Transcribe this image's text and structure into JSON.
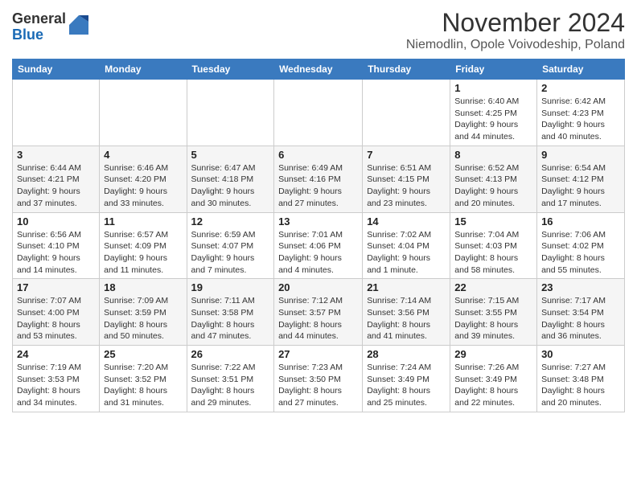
{
  "header": {
    "logo_general": "General",
    "logo_blue": "Blue",
    "month_year": "November 2024",
    "location": "Niemodlin, Opole Voivodeship, Poland"
  },
  "days_of_week": [
    "Sunday",
    "Monday",
    "Tuesday",
    "Wednesday",
    "Thursday",
    "Friday",
    "Saturday"
  ],
  "weeks": [
    [
      {
        "day": "",
        "info": ""
      },
      {
        "day": "",
        "info": ""
      },
      {
        "day": "",
        "info": ""
      },
      {
        "day": "",
        "info": ""
      },
      {
        "day": "",
        "info": ""
      },
      {
        "day": "1",
        "info": "Sunrise: 6:40 AM\nSunset: 4:25 PM\nDaylight: 9 hours\nand 44 minutes."
      },
      {
        "day": "2",
        "info": "Sunrise: 6:42 AM\nSunset: 4:23 PM\nDaylight: 9 hours\nand 40 minutes."
      }
    ],
    [
      {
        "day": "3",
        "info": "Sunrise: 6:44 AM\nSunset: 4:21 PM\nDaylight: 9 hours\nand 37 minutes."
      },
      {
        "day": "4",
        "info": "Sunrise: 6:46 AM\nSunset: 4:20 PM\nDaylight: 9 hours\nand 33 minutes."
      },
      {
        "day": "5",
        "info": "Sunrise: 6:47 AM\nSunset: 4:18 PM\nDaylight: 9 hours\nand 30 minutes."
      },
      {
        "day": "6",
        "info": "Sunrise: 6:49 AM\nSunset: 4:16 PM\nDaylight: 9 hours\nand 27 minutes."
      },
      {
        "day": "7",
        "info": "Sunrise: 6:51 AM\nSunset: 4:15 PM\nDaylight: 9 hours\nand 23 minutes."
      },
      {
        "day": "8",
        "info": "Sunrise: 6:52 AM\nSunset: 4:13 PM\nDaylight: 9 hours\nand 20 minutes."
      },
      {
        "day": "9",
        "info": "Sunrise: 6:54 AM\nSunset: 4:12 PM\nDaylight: 9 hours\nand 17 minutes."
      }
    ],
    [
      {
        "day": "10",
        "info": "Sunrise: 6:56 AM\nSunset: 4:10 PM\nDaylight: 9 hours\nand 14 minutes."
      },
      {
        "day": "11",
        "info": "Sunrise: 6:57 AM\nSunset: 4:09 PM\nDaylight: 9 hours\nand 11 minutes."
      },
      {
        "day": "12",
        "info": "Sunrise: 6:59 AM\nSunset: 4:07 PM\nDaylight: 9 hours\nand 7 minutes."
      },
      {
        "day": "13",
        "info": "Sunrise: 7:01 AM\nSunset: 4:06 PM\nDaylight: 9 hours\nand 4 minutes."
      },
      {
        "day": "14",
        "info": "Sunrise: 7:02 AM\nSunset: 4:04 PM\nDaylight: 9 hours\nand 1 minute."
      },
      {
        "day": "15",
        "info": "Sunrise: 7:04 AM\nSunset: 4:03 PM\nDaylight: 8 hours\nand 58 minutes."
      },
      {
        "day": "16",
        "info": "Sunrise: 7:06 AM\nSunset: 4:02 PM\nDaylight: 8 hours\nand 55 minutes."
      }
    ],
    [
      {
        "day": "17",
        "info": "Sunrise: 7:07 AM\nSunset: 4:00 PM\nDaylight: 8 hours\nand 53 minutes."
      },
      {
        "day": "18",
        "info": "Sunrise: 7:09 AM\nSunset: 3:59 PM\nDaylight: 8 hours\nand 50 minutes."
      },
      {
        "day": "19",
        "info": "Sunrise: 7:11 AM\nSunset: 3:58 PM\nDaylight: 8 hours\nand 47 minutes."
      },
      {
        "day": "20",
        "info": "Sunrise: 7:12 AM\nSunset: 3:57 PM\nDaylight: 8 hours\nand 44 minutes."
      },
      {
        "day": "21",
        "info": "Sunrise: 7:14 AM\nSunset: 3:56 PM\nDaylight: 8 hours\nand 41 minutes."
      },
      {
        "day": "22",
        "info": "Sunrise: 7:15 AM\nSunset: 3:55 PM\nDaylight: 8 hours\nand 39 minutes."
      },
      {
        "day": "23",
        "info": "Sunrise: 7:17 AM\nSunset: 3:54 PM\nDaylight: 8 hours\nand 36 minutes."
      }
    ],
    [
      {
        "day": "24",
        "info": "Sunrise: 7:19 AM\nSunset: 3:53 PM\nDaylight: 8 hours\nand 34 minutes."
      },
      {
        "day": "25",
        "info": "Sunrise: 7:20 AM\nSunset: 3:52 PM\nDaylight: 8 hours\nand 31 minutes."
      },
      {
        "day": "26",
        "info": "Sunrise: 7:22 AM\nSunset: 3:51 PM\nDaylight: 8 hours\nand 29 minutes."
      },
      {
        "day": "27",
        "info": "Sunrise: 7:23 AM\nSunset: 3:50 PM\nDaylight: 8 hours\nand 27 minutes."
      },
      {
        "day": "28",
        "info": "Sunrise: 7:24 AM\nSunset: 3:49 PM\nDaylight: 8 hours\nand 25 minutes."
      },
      {
        "day": "29",
        "info": "Sunrise: 7:26 AM\nSunset: 3:49 PM\nDaylight: 8 hours\nand 22 minutes."
      },
      {
        "day": "30",
        "info": "Sunrise: 7:27 AM\nSunset: 3:48 PM\nDaylight: 8 hours\nand 20 minutes."
      }
    ]
  ]
}
